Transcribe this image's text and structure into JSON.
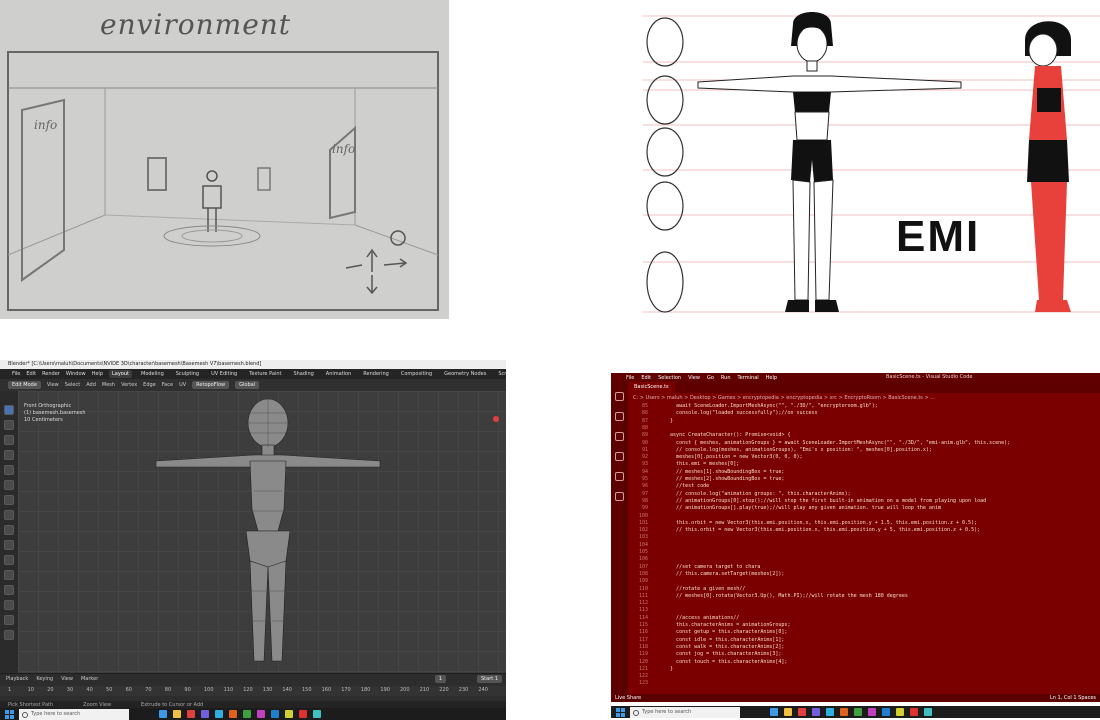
{
  "sketch": {
    "title": "environment",
    "info_left": "info",
    "info_right": "info"
  },
  "character": {
    "label": "EMI"
  },
  "blender": {
    "window_title": "Blender* [C:\\Users\\maluh\\Documents\\NVIDE 3D\\character\\basemesh\\Basemesh V7\\basemesh.blend]",
    "menu": [
      "File",
      "Edit",
      "Render",
      "Window",
      "Help"
    ],
    "workspaces": [
      "Layout",
      "Modeling",
      "Sculpting",
      "UV Editing",
      "Texture Paint",
      "Shading",
      "Animation",
      "Rendering",
      "Compositing",
      "Geometry Nodes",
      "Scripting"
    ],
    "active_workspace": "Layout",
    "mode": "Edit Mode",
    "header_menu": [
      "View",
      "Select",
      "Add",
      "Mesh",
      "Vertex",
      "Edge",
      "Face",
      "UV"
    ],
    "retopoflow": "RetopoFlow",
    "transform": "Global",
    "viewport_info": [
      "Front Orthographic",
      "(1) basemesh.basemesh",
      "10 Centimeters"
    ],
    "timeline": {
      "menu": [
        "Playback",
        "Keying",
        "View",
        "Marker"
      ],
      "ticks": [
        "1",
        "10",
        "20",
        "30",
        "40",
        "50",
        "60",
        "70",
        "80",
        "90",
        "100",
        "110",
        "120",
        "130",
        "140",
        "150",
        "160",
        "170",
        "180",
        "190",
        "200",
        "210",
        "220",
        "230",
        "240"
      ],
      "frame": "1",
      "start_label": "Start",
      "start": "1"
    },
    "status": [
      "Pick Shortest Path",
      "Zoom View",
      "Extrude to Cursor or Add"
    ]
  },
  "vscode": {
    "menu": [
      "File",
      "Edit",
      "Selection",
      "View",
      "Go",
      "Run",
      "Terminal",
      "Help"
    ],
    "window_title": "BasicScene.ts - Visual Studio Code",
    "tab": "BasicScene.ts",
    "breadcrumb": "C: > Users > maluh > Desktop > Games > encryptopedia > encryptopedia > src > EncryptoRoom > BasicScene.ts > ...",
    "status_left": "Live Share",
    "status_right": "Ln 1, Col 1  Spaces",
    "lines": [
      {
        "n": "85",
        "code": "      await SceneLoader.ImportMeshAsync(\"\", \"./3D/\", \"encryptoroom.glb\");"
      },
      {
        "n": "86",
        "code": "      console.log(\"loaded successfully\");//on success"
      },
      {
        "n": "87",
        "code": "    }"
      },
      {
        "n": "88",
        "code": ""
      },
      {
        "n": "89",
        "code": "    async CreateCharacter(): Promise<void> {"
      },
      {
        "n": "90",
        "code": "      const { meshes, animationGroups } = await SceneLoader.ImportMeshAsync(\"\", \"./3D/\", \"emi-anim.glb\", this.scene);"
      },
      {
        "n": "91",
        "code": "      // console.log(meshes, animationGroups), \"Emi's x position: \", meshes[0].position.x);"
      },
      {
        "n": "92",
        "code": "      meshes[0].position = new Vector3(0, 0, 0);"
      },
      {
        "n": "93",
        "code": "      this.emi = meshes[0];"
      },
      {
        "n": "94",
        "code": "      // meshes[1].showBoundingBox = true;"
      },
      {
        "n": "95",
        "code": "      // meshes[2].showBoundingBox = true;"
      },
      {
        "n": "96",
        "code": "      //test code"
      },
      {
        "n": "97",
        "code": "      // console.log(\"animation groups: \", this.characterAnims);"
      },
      {
        "n": "98",
        "code": "      // animationGroups[0].stop();//will stop the first built-in animation on a model from playing upon load"
      },
      {
        "n": "99",
        "code": "      // animationGroups[].play(true);//will play any given animation. true will loop the anim"
      },
      {
        "n": "100",
        "code": ""
      },
      {
        "n": "101",
        "code": "      this.orbit = new Vector3(this.emi.position.x, this.emi.position.y + 1.5, this.emi.position.z + 0.5);"
      },
      {
        "n": "102",
        "code": "      // this.orbit = new Vector3(this.emi.position.x, this.emi.position.y + 5, this.emi.position.z + 0.5);"
      },
      {
        "n": "103",
        "code": ""
      },
      {
        "n": "104",
        "code": ""
      },
      {
        "n": "105",
        "code": ""
      },
      {
        "n": "106",
        "code": ""
      },
      {
        "n": "107",
        "code": "      //set camera target to chara"
      },
      {
        "n": "108",
        "code": "      // this.camera.setTarget(meshes[2]);"
      },
      {
        "n": "109",
        "code": ""
      },
      {
        "n": "110",
        "code": "      //rotate a given mesh//"
      },
      {
        "n": "111",
        "code": "      // meshes[0].rotate(Vector3.Up(), Math.PI);//will rotate the mesh 180 degrees"
      },
      {
        "n": "112",
        "code": ""
      },
      {
        "n": "113",
        "code": ""
      },
      {
        "n": "114",
        "code": "      //access animations//"
      },
      {
        "n": "115",
        "code": "      this.characterAnims = animationGroups;"
      },
      {
        "n": "116",
        "code": "      const getup = this.characterAnims[0];"
      },
      {
        "n": "117",
        "code": "      const idle = this.characterAnims[1];"
      },
      {
        "n": "118",
        "code": "      const walk = this.characterAnims[2];"
      },
      {
        "n": "119",
        "code": "      const jog = this.characterAnims[3];"
      },
      {
        "n": "120",
        "code": "      const touch = this.characterAnims[4];"
      },
      {
        "n": "121",
        "code": "    }"
      },
      {
        "n": "122",
        "code": ""
      },
      {
        "n": "123",
        "code": ""
      }
    ]
  },
  "taskbar": {
    "search_placeholder": "Type here to search",
    "app_colors": [
      "#3c9ae8",
      "#f0c040",
      "#e04040",
      "#7060e0",
      "#30b0e0",
      "#e06020",
      "#40a040",
      "#c040c0",
      "#2080d0",
      "#d0d030",
      "#e03030",
      "#40c0c0"
    ]
  }
}
